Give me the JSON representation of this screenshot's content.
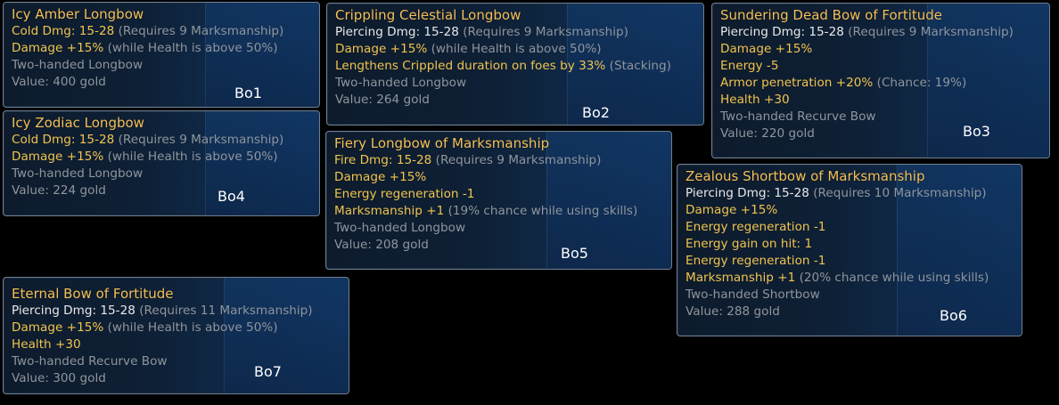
{
  "tooltips": {
    "bo1": {
      "name": "Icy Amber Longbow",
      "l1_a": "Cold Dmg: 15-28",
      "l1_b": "(Requires 9 Marksmanship)",
      "l2_a": "Damage +15%",
      "l2_b": "(while Health is above 50%)",
      "type": "Two-handed Longbow",
      "value": "Value: 400 gold",
      "code": "Bo1"
    },
    "bo2": {
      "name": "Crippling Celestial Longbow",
      "l1_a": "Piercing Dmg: 15-28",
      "l1_b": "(Requires 9 Marksmanship)",
      "l2_a": "Damage +15%",
      "l2_b": "(while Health is above 50%)",
      "l3_a": "Lengthens Crippled duration on foes by 33%",
      "l3_b": "(Stacking)",
      "type": "Two-handed Longbow",
      "value": "Value: 264 gold",
      "code": "Bo2"
    },
    "bo3": {
      "name": "Sundering Dead Bow of Fortitude",
      "l1_a": "Piercing Dmg: 15-28",
      "l1_b": "(Requires 9 Marksmanship)",
      "l2": "Damage +15%",
      "l3": "Energy -5",
      "l4_a": "Armor penetration +20%",
      "l4_b": "(Chance: 19%)",
      "l5": "Health +30",
      "type": "Two-handed Recurve Bow",
      "value": "Value: 220 gold",
      "code": "Bo3"
    },
    "bo4": {
      "name": "Icy Zodiac Longbow",
      "l1_a": "Cold Dmg: 15-28",
      "l1_b": "(Requires 9 Marksmanship)",
      "l2_a": "Damage +15%",
      "l2_b": "(while Health is above 50%)",
      "type": "Two-handed Longbow",
      "value": "Value: 224 gold",
      "code": "Bo4"
    },
    "bo5": {
      "name": "Fiery Longbow of Marksmanship",
      "l1_a": "Fire Dmg: 15-28",
      "l1_b": "(Requires 9 Marksmanship)",
      "l2": "Damage +15%",
      "l3": "Energy regeneration -1",
      "l4_a": "Marksmanship +1",
      "l4_b": "(19% chance while using skills)",
      "type": "Two-handed Longbow",
      "value": "Value: 208 gold",
      "code": "Bo5"
    },
    "bo6": {
      "name": "Zealous Shortbow of Marksmanship",
      "l1_a": "Piercing Dmg: 15-28",
      "l1_b": "(Requires 10 Marksmanship)",
      "l2": "Damage +15%",
      "l3": "Energy regeneration -1",
      "l4": "Energy gain on hit: 1",
      "l5": "Energy regeneration -1",
      "l6_a": "Marksmanship +1",
      "l6_b": "(20% chance while using skills)",
      "type": "Two-handed Shortbow",
      "value": "Value: 288 gold",
      "code": "Bo6"
    },
    "bo7": {
      "name": "Eternal Bow of Fortitude",
      "l1_a": "Piercing Dmg: 15-28",
      "l1_b": "(Requires 11 Marksmanship)",
      "l2_a": "Damage +15%",
      "l2_b": "(while Health is above 50%)",
      "l3": "Health +30",
      "type": "Two-handed Recurve Bow",
      "value": "Value: 300 gold",
      "code": "Bo7"
    }
  },
  "colors": {
    "title": "#f4c15a",
    "modifier": "#f0c44e",
    "base_stat": "#e8e8e8",
    "note": "#8f959c",
    "code_label": "#ffffff"
  }
}
